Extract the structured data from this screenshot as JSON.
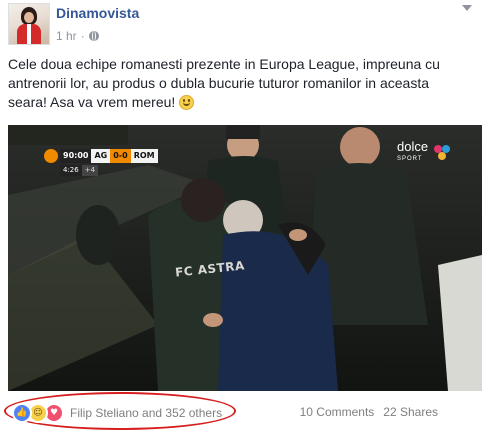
{
  "post": {
    "author": "Dinamovista",
    "time": "1 hr",
    "text_line1": "Cele doua echipe romanesti prezente in Europa League, impreuna cu",
    "text_line2": "antrenorii lor, au produs o dubla bucurie tuturor romanilor in aceasta",
    "text_line3": "seara! Asa va vrem mereu!",
    "icons": {
      "privacy": "globe-icon",
      "options": "chevron-down-icon",
      "emoji": "smile-emoji"
    }
  },
  "photo": {
    "scoreboard": {
      "time": "90:00",
      "home": "AG",
      "score": "0-0",
      "away": "ROM",
      "clock": "4:26",
      "added": "+4"
    },
    "channel": {
      "name": "dolce",
      "sub": "SPORT"
    },
    "jersey": "FC ASTRA"
  },
  "footer": {
    "reaction_icons": [
      "like-icon",
      "haha-icon",
      "love-icon"
    ],
    "reactions_text": "Filip Steliano and 352 others",
    "comments": "10 Comments",
    "shares": "22 Shares",
    "highlight_color": "#d61f1f"
  },
  "colors": {
    "link": "#365899",
    "meta": "#90949c",
    "like": "#4c82f6",
    "love": "#f0506e",
    "scoreboard_accent": "#f08a00"
  }
}
